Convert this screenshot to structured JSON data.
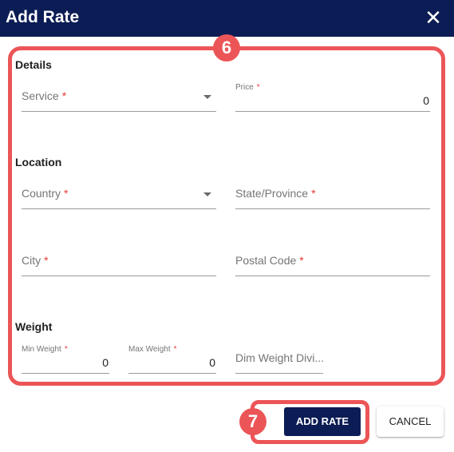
{
  "dialog": {
    "title": "Add Rate",
    "close_icon": "close-icon"
  },
  "callouts": {
    "form_marker": "6",
    "button_marker": "7",
    "color": "#ec5557"
  },
  "sections": {
    "details": "Details",
    "location": "Location",
    "weight": "Weight"
  },
  "fields": {
    "service": {
      "label": "Service",
      "required": "*",
      "value": ""
    },
    "price": {
      "label": "Price",
      "required": "*",
      "value": "0"
    },
    "country": {
      "label": "Country",
      "required": "*",
      "value": ""
    },
    "state": {
      "label": "State/Province",
      "required": "*",
      "value": ""
    },
    "city": {
      "label": "City",
      "required": "*",
      "value": ""
    },
    "postal_code": {
      "label": "Postal Code",
      "required": "*",
      "value": ""
    },
    "min_weight": {
      "label": "Min Weight",
      "required": "*",
      "value": "0"
    },
    "max_weight": {
      "label": "Max Weight",
      "required": "*",
      "value": "0"
    },
    "dim_weight_divisor": {
      "label": "Dim Weight Divi...",
      "value": ""
    }
  },
  "actions": {
    "add_rate": "ADD RATE",
    "cancel": "CANCEL"
  },
  "colors": {
    "header_bg": "#0c1c54",
    "primary": "#0c1c54",
    "required": "#e53935"
  }
}
